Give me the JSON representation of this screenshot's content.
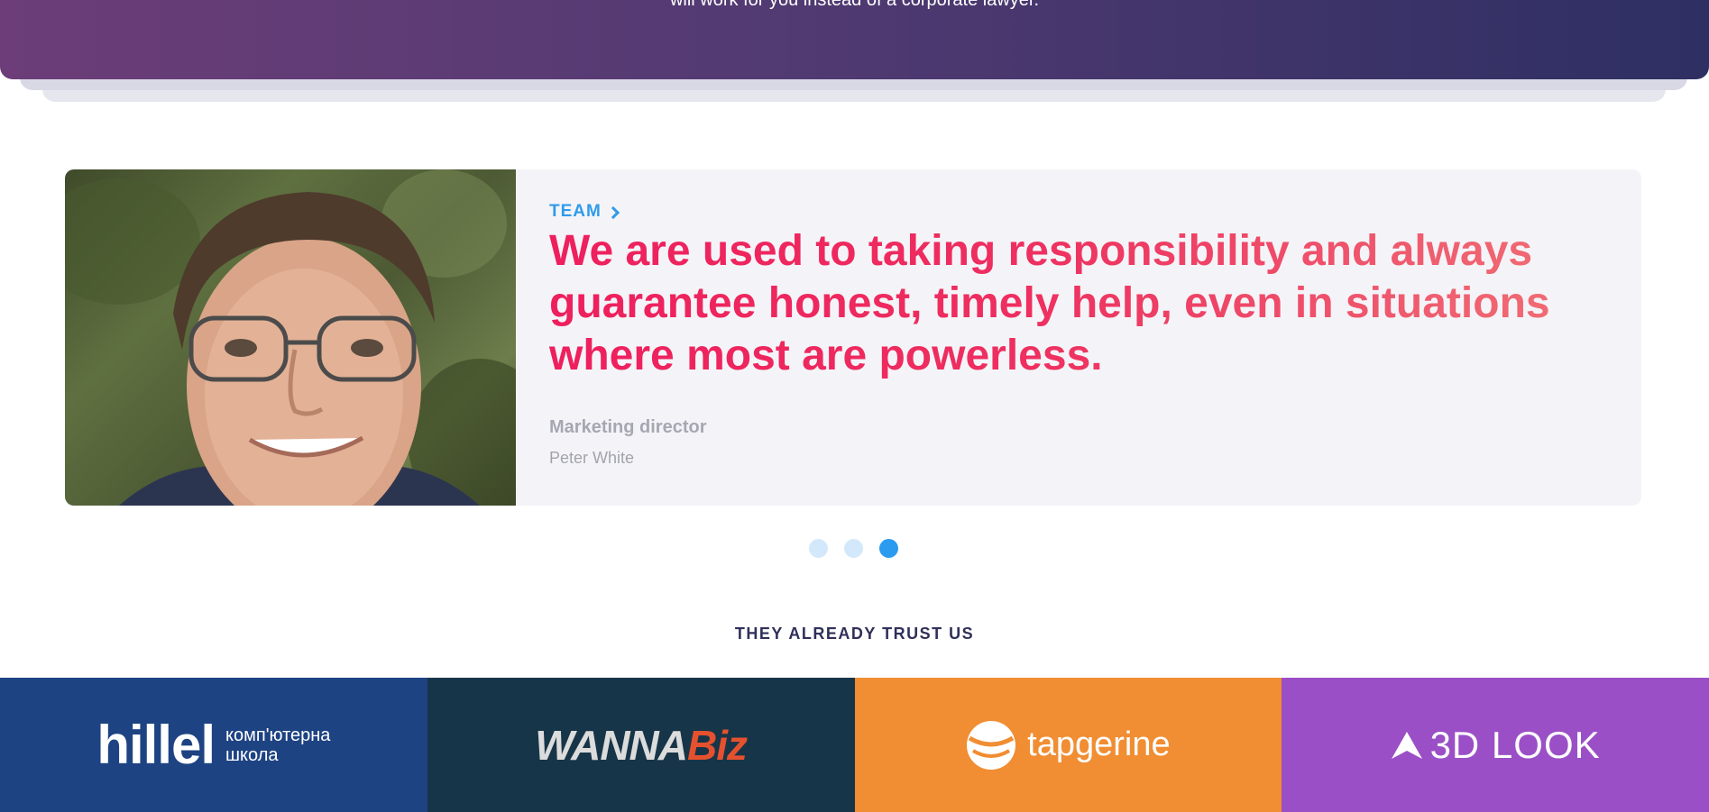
{
  "hero": {
    "text": "will work for you instead of a corporate lawyer."
  },
  "testimonial": {
    "section_link": "TEAM",
    "quote": "We are used to taking responsibility and always guarantee honest, timely help, even in situations where most are powerless.",
    "role": "Marketing director",
    "name": "Peter White"
  },
  "carousel": {
    "dots": 3,
    "active_index": 2
  },
  "trust": {
    "heading": "THEY ALREADY TRUST US",
    "logos": [
      {
        "name": "hillel",
        "line1": "hillel",
        "line2a": "комп'ютерна",
        "line2b": "школа",
        "bg": "#1e4383"
      },
      {
        "name": "wannabiz",
        "part1": "WANNA",
        "part2": "Biz",
        "bg": "#173548"
      },
      {
        "name": "tapgerine",
        "text": "tapgerine",
        "bg": "#f18d32"
      },
      {
        "name": "3dlook",
        "text": "3D LOOK",
        "bg": "#9b4fc6"
      }
    ]
  },
  "colors": {
    "accent_blue": "#2a9bef",
    "quote_pink": "#ee1f5d",
    "hero_gradient_start": "#6c3d78",
    "hero_gradient_end": "#2e2f63"
  }
}
